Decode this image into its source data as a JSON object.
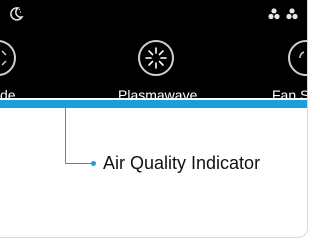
{
  "buttons": {
    "left_label": "de",
    "center_label": "Plasmawave",
    "right_label": "Fan S"
  },
  "callout": {
    "text": "Air Quality Indicator"
  },
  "colors": {
    "panel": "#000000",
    "indicator": "#1a9fdb"
  },
  "icons": {
    "top_left": "moon-night-icon",
    "top_right": "fan-speed-icons",
    "center": "plasmawave-icon"
  }
}
